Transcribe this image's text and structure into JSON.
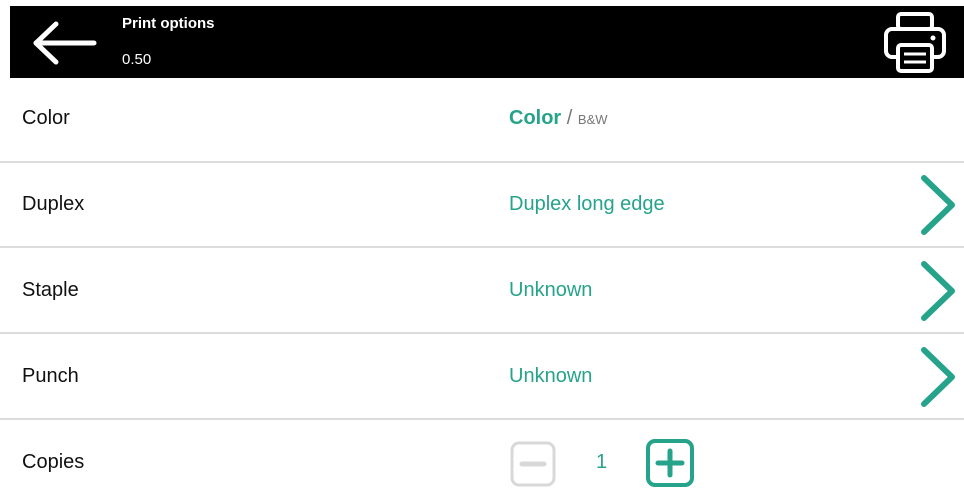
{
  "header": {
    "title": "Print options",
    "amount": "0.50",
    "back_icon": "arrow-left-icon",
    "print_icon": "printer-icon"
  },
  "options": {
    "color": {
      "label": "Color",
      "selected": "Color",
      "separator": "/",
      "alternative": "B&W"
    },
    "duplex": {
      "label": "Duplex",
      "value": "Duplex long edge"
    },
    "staple": {
      "label": "Staple",
      "value": "Unknown"
    },
    "punch": {
      "label": "Punch",
      "value": "Unknown"
    },
    "copies": {
      "label": "Copies",
      "value": "1"
    }
  },
  "colors": {
    "accent": "#26a38b",
    "header_bg": "#000000",
    "divider": "#dcdcdc",
    "disabled": "#d8d8d8"
  }
}
